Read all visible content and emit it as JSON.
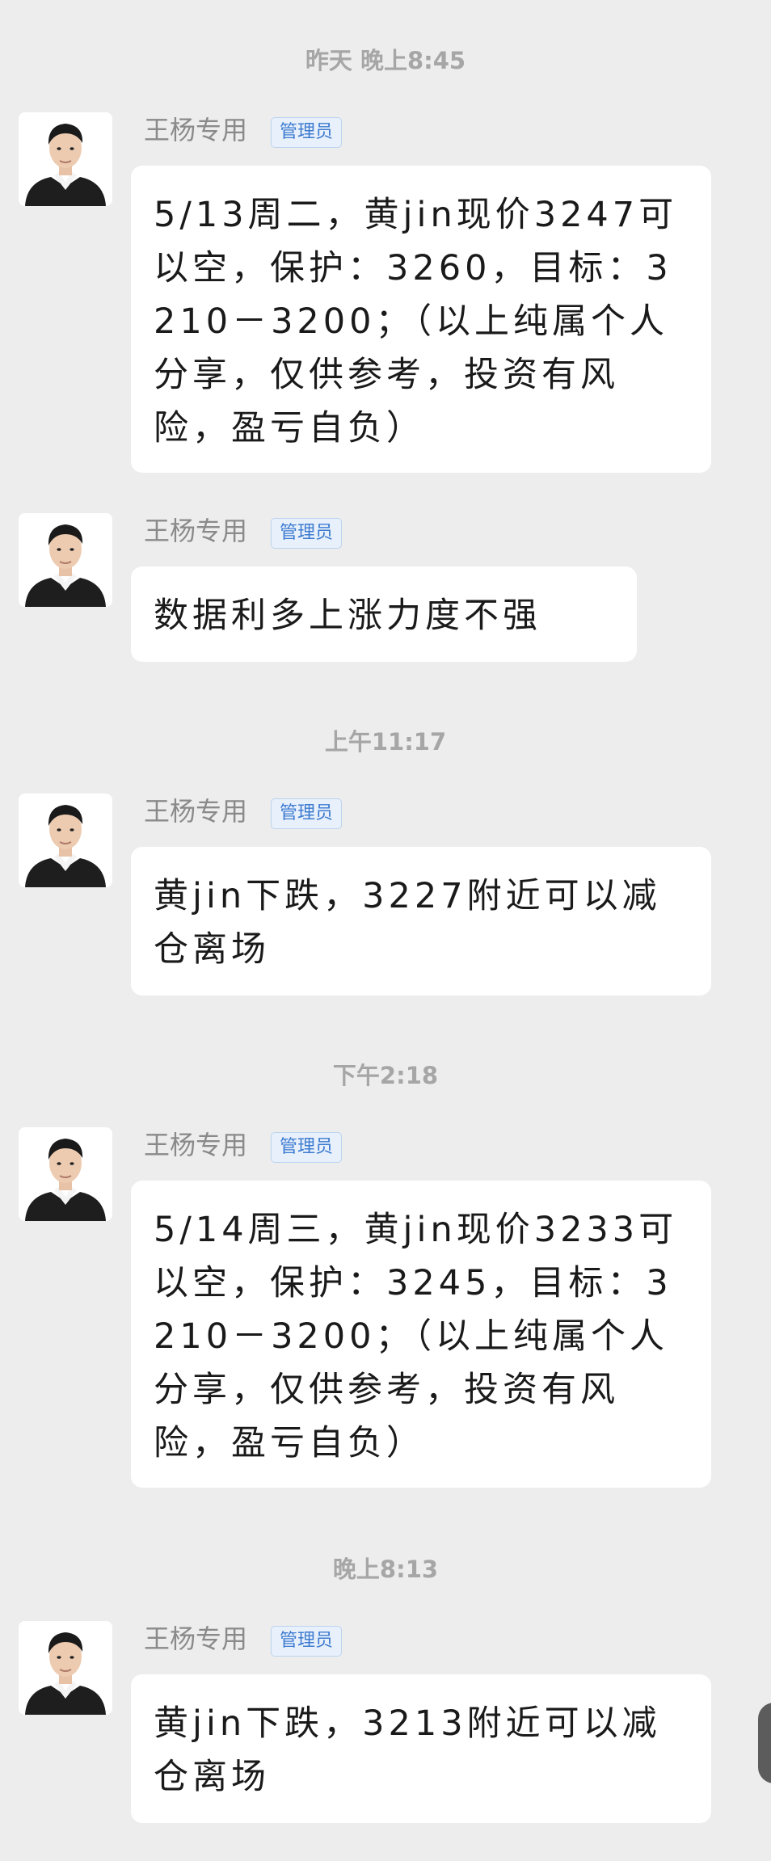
{
  "timestamps": [
    "昨天 晚上8:45",
    "上午11:17",
    "下午2:18",
    "晚上8:13"
  ],
  "messages": [
    {
      "sender": "王杨专用",
      "badge": "管理员",
      "text": "5/13周二，黄jin现价3247可以空，保护：3260，目标：3210－3200；（以上纯属个人分享，仅供参考，投资有风险，盈亏自负）"
    },
    {
      "sender": "王杨专用",
      "badge": "管理员",
      "text": "数据利多上涨力度不强"
    },
    {
      "sender": "王杨专用",
      "badge": "管理员",
      "text": "黄jin下跌，3227附近可以减仓离场"
    },
    {
      "sender": "王杨专用",
      "badge": "管理员",
      "text": "5/14周三，黄jin现价3233可以空，保护：3245，目标：3210－3200；（以上纯属个人分享，仅供参考，投资有风险，盈亏自负）"
    },
    {
      "sender": "王杨专用",
      "badge": "管理员",
      "text": "黄jin下跌，3213附近可以减仓离场"
    }
  ],
  "colors": {
    "background": "#EDEDED",
    "bubble": "#FFFFFF",
    "badge_text": "#3D7BD0",
    "badge_bg": "#E8F0FB",
    "timestamp": "#A6A6A6",
    "sender": "#8A8A8A"
  },
  "icons": {
    "avatar": "profile-photo"
  }
}
